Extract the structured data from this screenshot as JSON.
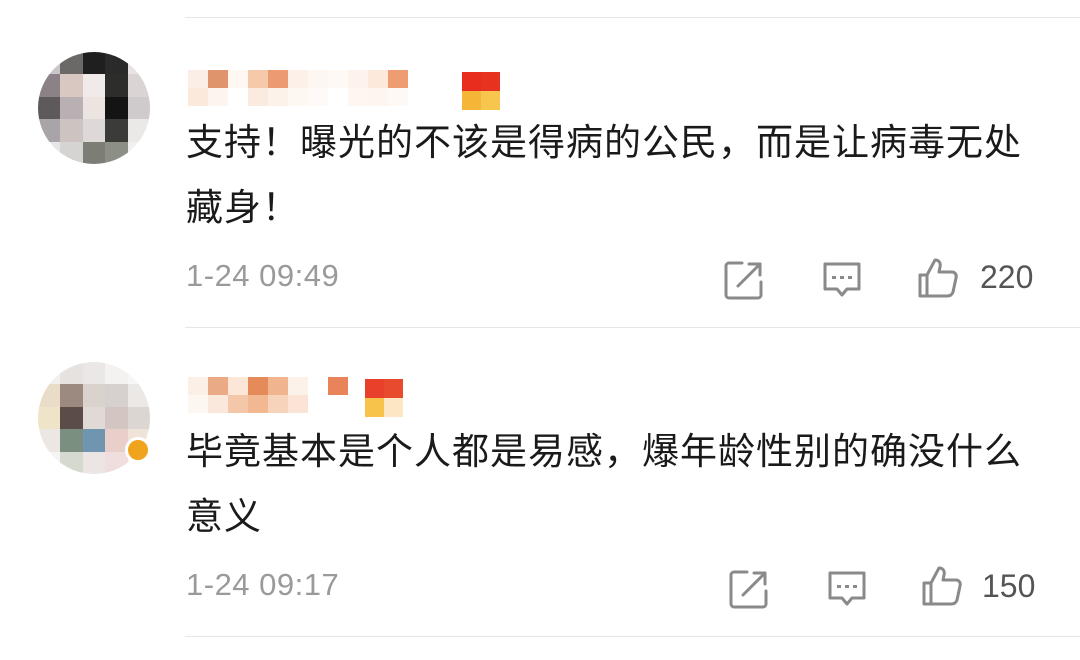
{
  "comments": [
    {
      "text": "支持！曝光的不该是得病的公民，而是让病毒无处藏身！",
      "time": "1-24 09:49",
      "likes": "220"
    },
    {
      "text": "毕竟基本是个人都是易感，爆年龄性别的确没什么意义",
      "time": "1-24 09:17",
      "likes": "150"
    }
  ],
  "icons": {
    "share": "share-icon",
    "reply": "comment-icon",
    "like": "thumbs-up-icon"
  },
  "colors": {
    "text": "#1a1a1a",
    "meta": "#9a9a9a",
    "divider": "#e6e6e6",
    "icon": "#8a8a8a"
  }
}
